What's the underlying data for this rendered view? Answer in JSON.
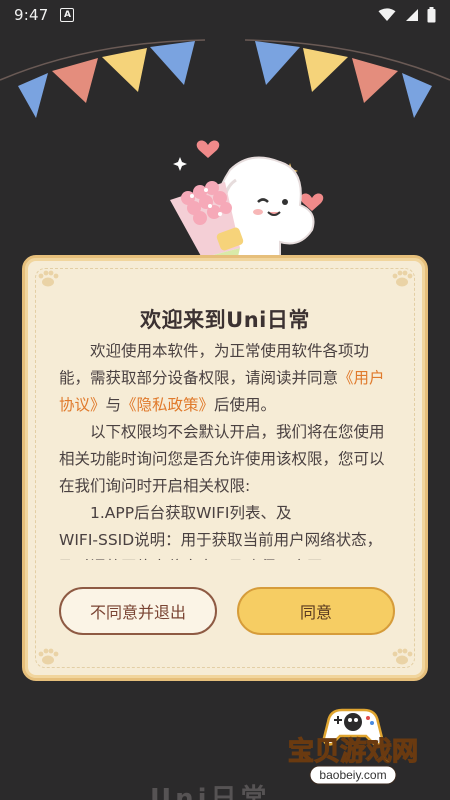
{
  "status_bar": {
    "time": "9:47",
    "notification_glyph": "A"
  },
  "dialog": {
    "title": "欢迎来到Uni日常",
    "body": {
      "para1_pre": "欢迎使用本软件，为正常使用软件各项功能，需获取部分设备权限，请阅读并同意",
      "user_agreement": "《用户协议》",
      "and": "与",
      "privacy_policy": "《隐私政策》",
      "para1_post": "后使用。",
      "para2": "以下权限均不会默认开启，我们将在您使用相关功能时询问您是否允许使用该权限，您可以在我们询问时开启相关权限:",
      "item1_title": "1.APP后台获取WIFI列表、及",
      "item1_desc": "WIFI-SSID说明：用于获取当前用户网络状态，及时调整网络定位方案，及确保用户网"
    },
    "decline_label": "不同意并退出",
    "agree_label": "同意"
  },
  "background_text": "Uni日常",
  "watermark": {
    "brand": "宝贝游戏网",
    "url": "baobeiy.com"
  },
  "colors": {
    "background": "#2b2a2b",
    "card": "#f6ecd6",
    "link": "#e07a2c",
    "agree": "#f6cd63",
    "decline_border": "#8e5a43"
  },
  "icons": [
    "wifi-icon",
    "signal-icon",
    "battery-icon",
    "paw-icon",
    "heart-icon",
    "sparkle-icon"
  ]
}
